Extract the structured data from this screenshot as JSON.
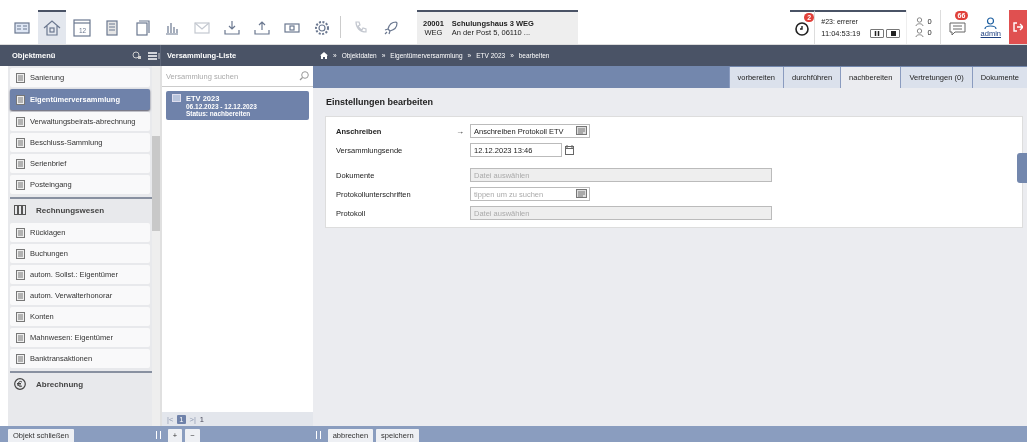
{
  "toolbar_buttons": [
    {
      "selected": false,
      "disabled": false
    },
    {
      "selected": true,
      "disabled": false
    },
    {
      "selected": false,
      "disabled": false,
      "label": "12"
    },
    {
      "selected": false,
      "disabled": false
    },
    {
      "selected": false,
      "disabled": false
    },
    {
      "selected": false,
      "disabled": false
    },
    {
      "selected": false,
      "disabled": true
    },
    {
      "selected": false,
      "disabled": false
    },
    {
      "selected": false,
      "disabled": false
    },
    {
      "selected": false,
      "disabled": false
    },
    {
      "selected": false,
      "disabled": false
    },
    {
      "selected": false,
      "disabled": true
    },
    {
      "selected": false,
      "disabled": false
    }
  ],
  "property": {
    "number": "20001",
    "type": "WEG",
    "name": "Schulungshaus 3 WEG",
    "address": "An der Post 5, 06110 ..."
  },
  "timer": {
    "badge": "2",
    "task": "#23: errerer",
    "time": "11:04:53:19"
  },
  "counters": [
    "0",
    "0"
  ],
  "messages_badge": "66",
  "user": "admin",
  "sidebar": {
    "title": "Objektmenü",
    "items": [
      {
        "kind": "item",
        "label": "Sanierung",
        "selected": false
      },
      {
        "kind": "item",
        "label": "Eigentümerversammlung",
        "selected": true
      },
      {
        "kind": "item",
        "label": "Verwaltungsbeirats-abrechnung",
        "selected": false
      },
      {
        "kind": "item",
        "label": "Beschluss-Sammlung",
        "selected": false
      },
      {
        "kind": "item",
        "label": "Serienbrief",
        "selected": false
      },
      {
        "kind": "item",
        "label": "Posteingang",
        "selected": false
      },
      {
        "kind": "header",
        "label": "Rechnungswesen"
      },
      {
        "kind": "item",
        "label": "Rücklagen",
        "selected": false
      },
      {
        "kind": "item",
        "label": "Buchungen",
        "selected": false
      },
      {
        "kind": "item",
        "label": "autom. Sollst.: Eigentümer",
        "selected": false
      },
      {
        "kind": "item",
        "label": "autom. Verwalterhonorar",
        "selected": false
      },
      {
        "kind": "item",
        "label": "Konten",
        "selected": false
      },
      {
        "kind": "item",
        "label": "Mahnwesen: Eigentümer",
        "selected": false
      },
      {
        "kind": "item",
        "label": "Banktransaktionen",
        "selected": false
      },
      {
        "kind": "header2",
        "label": "Abrechnung"
      }
    ]
  },
  "list": {
    "title": "Versammlung-Liste",
    "search_placeholder": "Versammlung suchen",
    "items": [
      {
        "title": "ETV 2023",
        "dates": "06.12.2023 - 12.12.2023",
        "status": "Status: nachbereiten",
        "selected": true
      }
    ],
    "pager": {
      "first": "|<",
      "page": "1",
      "last": ">|",
      "total": "1"
    }
  },
  "breadcrumb": {
    "separator": "»",
    "items": [
      "Objektdaten",
      "Eigentümerversammlung",
      "ETV 2023",
      "bearbeiten"
    ]
  },
  "tabs": [
    {
      "label": "vorbereiten",
      "selected": false
    },
    {
      "label": "durchführen",
      "selected": false
    },
    {
      "label": "nachbereiten",
      "selected": true
    },
    {
      "label": "Vertretungen (0)",
      "selected": false
    },
    {
      "label": "Dokumente",
      "selected": false
    }
  ],
  "form": {
    "title": "Einstellungen bearbeiten",
    "fields": [
      {
        "kind": "lookup",
        "label": "Anschreiben",
        "required": true,
        "marker": "→",
        "value": "Anschreiben Protokoll ETV"
      },
      {
        "kind": "date",
        "label": "Versammlungsende",
        "required": false,
        "value": "12.12.2023 13:46"
      },
      {
        "kind": "file",
        "label": "Dokumente",
        "required": false,
        "placeholder": "Datei auswählen"
      },
      {
        "kind": "lookup",
        "label": "Protokollunterschriften",
        "required": false,
        "placeholder": "tippen um zu suchen"
      },
      {
        "kind": "file",
        "label": "Protokoll",
        "required": false,
        "placeholder": "Datei auswählen"
      }
    ]
  },
  "bottom": {
    "close": "Objekt schließen",
    "add": "+",
    "remove": "−",
    "cancel": "abbrechen",
    "save": "speichern"
  }
}
